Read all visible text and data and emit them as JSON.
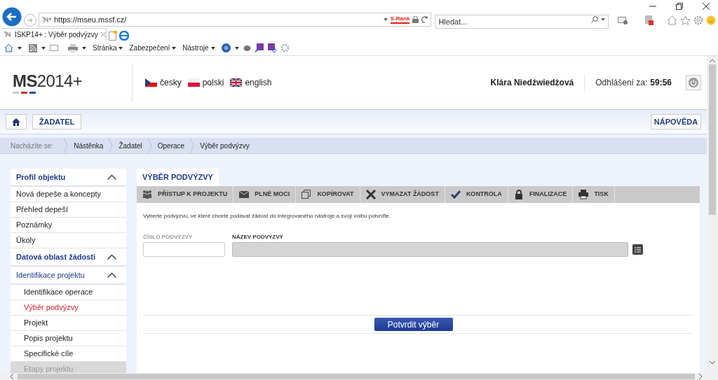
{
  "browser": {
    "address": "https://mseu.mssf.cz/",
    "rank_badge": "S-Rank",
    "search": {
      "placeholder": "Hledat..."
    },
    "tabs": [
      {
        "label": "ISKP14+ : Výběr podvýzvy",
        "selected": true
      }
    ],
    "menus": [
      "Stránka",
      "Zabezpečení",
      "Nástroje"
    ]
  },
  "header": {
    "logo_bold": "MS",
    "logo_rest": "2014+",
    "languages": [
      {
        "label": "česky",
        "kind": "cz"
      },
      {
        "label": "polski",
        "kind": "pl"
      },
      {
        "label": "english",
        "kind": "gb"
      }
    ],
    "user": "Klára Niedźwiedżová",
    "logout_label": "Odhlášení za:",
    "logout_time": "59:56"
  },
  "nav": {
    "applicant_button": "ŽADATEL",
    "help_button": "NÁPOVĚDA"
  },
  "breadcrumb": {
    "label": "Nacházíte se:",
    "items": [
      "Nástěnka",
      "Žadatel",
      "Operace",
      "Výběr podvýzvy"
    ]
  },
  "sidebar": {
    "sections": [
      {
        "title": "Profil objektu",
        "kind": "section",
        "expanded": true,
        "children": [
          {
            "label": "Nová depeše a koncepty",
            "selected": false,
            "disabled": false
          },
          {
            "label": "Přehled depeší",
            "selected": false,
            "disabled": false
          },
          {
            "label": "Poznámky",
            "selected": false,
            "disabled": false
          },
          {
            "label": "Úkoly",
            "selected": false,
            "disabled": false
          }
        ]
      },
      {
        "title": "Datová oblast žádosti",
        "kind": "section",
        "expanded": true
      },
      {
        "title": "Identifikace projektu",
        "kind": "subsection",
        "expanded": true,
        "children": [
          {
            "label": "Identifikace operace",
            "selected": false,
            "disabled": false
          },
          {
            "label": "Výběr podvýzvy",
            "selected": true,
            "disabled": false
          },
          {
            "label": "Projekt",
            "selected": false,
            "disabled": false
          },
          {
            "label": "Popis projektu",
            "selected": false,
            "disabled": false
          },
          {
            "label": "Specifické cíle",
            "selected": false,
            "disabled": false
          },
          {
            "label": "Etapy projektu",
            "selected": false,
            "disabled": true
          }
        ]
      }
    ]
  },
  "main": {
    "tabs": [
      {
        "label": "VÝBĚR PODVÝZVY",
        "selected": true
      }
    ],
    "actions": [
      {
        "label": "PŘÍSTUP K PROJEKTU",
        "kind": "people"
      },
      {
        "label": "PLNÉ MOCI",
        "kind": "mail"
      },
      {
        "label": "KOPÍROVAT",
        "kind": "copy"
      },
      {
        "label": "VYMAZAT ŽÁDOST",
        "kind": "delete"
      },
      {
        "label": "KONTROLA",
        "kind": "check"
      },
      {
        "label": "FINALIZACE",
        "kind": "lock"
      },
      {
        "label": "TISK",
        "kind": "print"
      }
    ],
    "instruction": "Vyberte podvýzvu, ve které chcete podávat žádost do integrovaného nástroje a svoji volbu potvrďte.",
    "fields": [
      {
        "label": "ČÍSLO PODVÝZVY",
        "readonly": false
      },
      {
        "label": "NÁZEV PODVÝZVY",
        "readonly": true
      }
    ],
    "confirm_button": "Potvrdit výběr"
  }
}
